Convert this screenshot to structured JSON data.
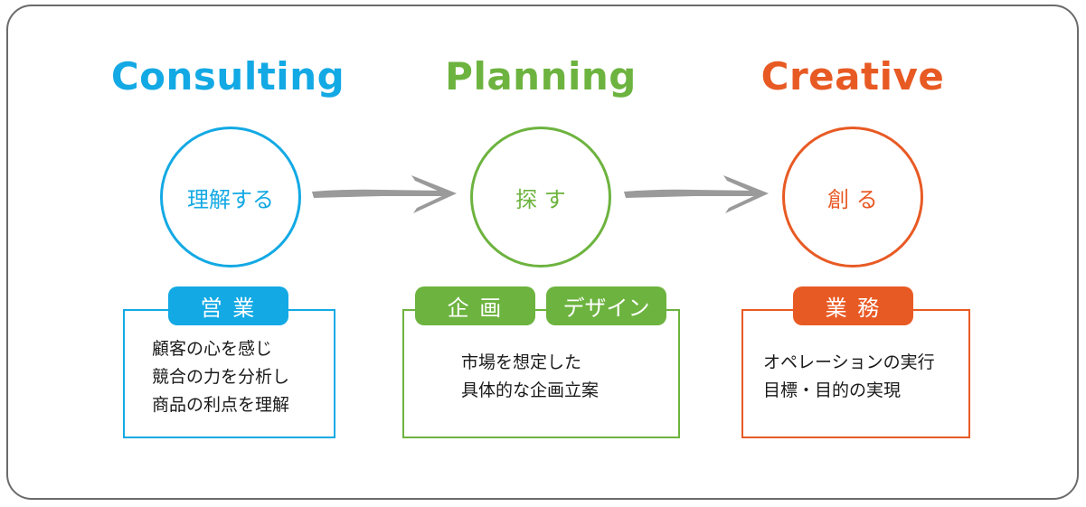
{
  "colors": {
    "consulting": "#13a9e4",
    "planning": "#6db33f",
    "creative": "#e85a24",
    "arrow": "#9a9a9a",
    "frame": "#6b6b6b",
    "text": "#1a1a1a"
  },
  "stages": [
    {
      "title": "Consulting",
      "circle_label": "理解する",
      "tags": [
        "営 業"
      ],
      "lines": [
        "顧客の心を感じ",
        "競合の力を分析し",
        "商品の利点を理解"
      ]
    },
    {
      "title": "Planning",
      "circle_label": "探 す",
      "tags": [
        "企 画",
        "デザイン"
      ],
      "lines": [
        "市場を想定した",
        "具体的な企画立案"
      ]
    },
    {
      "title": "Creative",
      "circle_label": "創 る",
      "tags": [
        "業 務"
      ],
      "lines": [
        "オペレーションの実行",
        "目標・目的の実現"
      ]
    }
  ],
  "arrows": [
    {
      "from": "Consulting",
      "to": "Planning",
      "icon": "arrow-right-icon"
    },
    {
      "from": "Planning",
      "to": "Creative",
      "icon": "arrow-right-icon"
    }
  ]
}
